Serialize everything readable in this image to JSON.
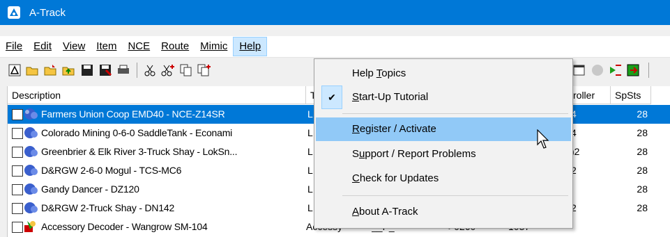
{
  "window": {
    "title": "A-Track"
  },
  "menubar": [
    {
      "label": "File"
    },
    {
      "label": "Edit"
    },
    {
      "label": "View"
    },
    {
      "label": "Item"
    },
    {
      "label": "NCE"
    },
    {
      "label": "Route"
    },
    {
      "label": "Mimic"
    },
    {
      "label": "Help"
    }
  ],
  "columns": {
    "description": "Description",
    "type": "T",
    "controller": "roller",
    "spsts": "SpSts"
  },
  "rows": [
    {
      "description": "Farmers Union Coop EMD40 - NCE-Z14SR",
      "type": "L",
      "ctrl": "4",
      "spsts": "28"
    },
    {
      "description": "Colorado Mining 0-6-0 SaddleTank - Econami",
      "type": "L",
      "ctrl": "4",
      "spsts": "28"
    },
    {
      "description": "Greenbrier & Elk River 3-Truck Shay - LokSn...",
      "type": "L",
      "ctrl": ")2",
      "spsts": "28"
    },
    {
      "description": "D&RGW 2-6-0 Mogul - TCS-MC6",
      "type": "L",
      "ctrl": "2",
      "spsts": "28"
    },
    {
      "description": "Gandy Dancer - DZ120",
      "type": "L",
      "ctrl": "",
      "spsts": "28"
    },
    {
      "description": "D&RGW 2-Truck Shay - DN142",
      "type": "L",
      "ctrl": "2",
      "spsts": "28"
    },
    {
      "description": "Accessory Decoder - Wangrow SM-104",
      "type": "Accessy",
      "addr": "__P_",
      "hex": ">0260",
      "ctrl": "1037",
      "spsts": ""
    }
  ],
  "help_menu": {
    "items": [
      {
        "pre": "Help ",
        "ul": "T",
        "post": "opics"
      },
      {
        "pre": "",
        "ul": "S",
        "post": "tart-Up Tutorial"
      },
      {
        "pre": "",
        "ul": "R",
        "post": "egister / Activate"
      },
      {
        "pre": "S",
        "ul": "u",
        "post": "pport / Report Problems"
      },
      {
        "pre": "",
        "ul": "C",
        "post": "heck for Updates"
      },
      {
        "pre": "",
        "ul": "A",
        "post": "bout A-Track"
      }
    ]
  }
}
